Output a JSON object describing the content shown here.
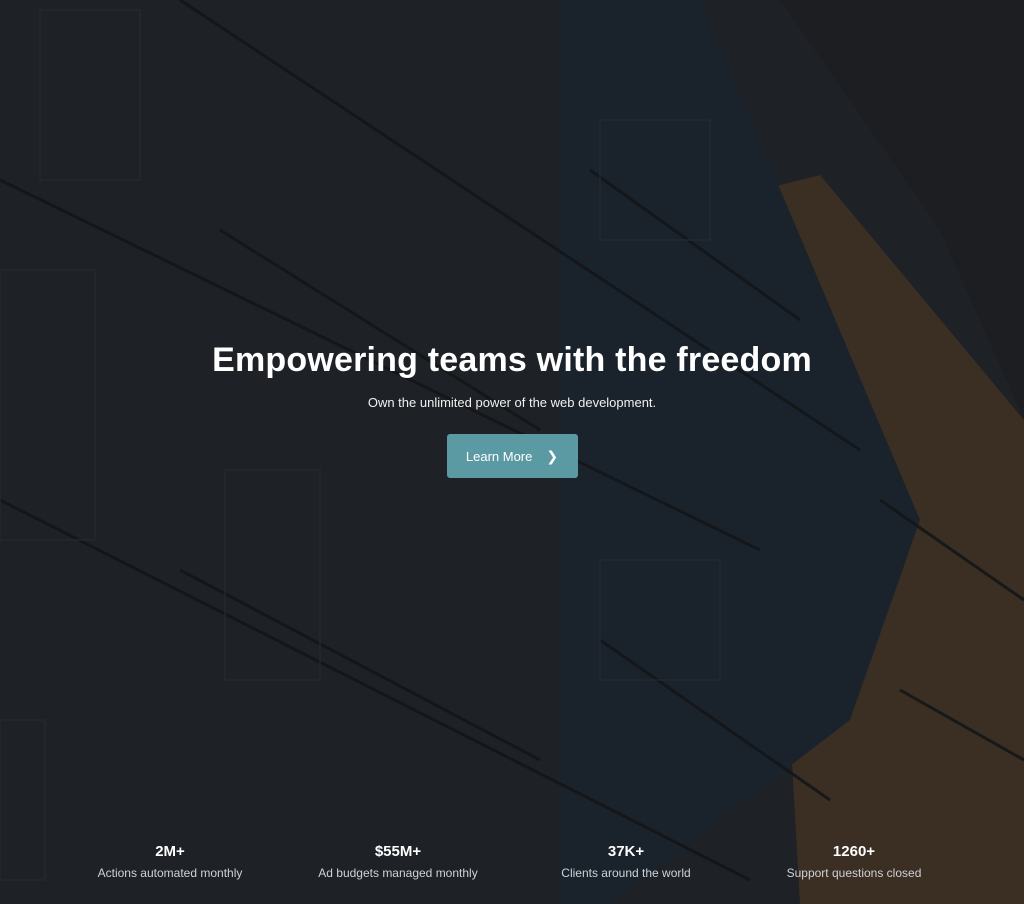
{
  "hero": {
    "title": "Empowering teams with the freedom",
    "subtitle": "Own the unlimited power of the web development.",
    "cta_label": "Learn More",
    "cta_icon": "chevron-right-icon"
  },
  "stats": [
    {
      "value": "2M+",
      "label": "Actions automated monthly"
    },
    {
      "value": "$55M+",
      "label": "Ad budgets managed monthly"
    },
    {
      "value": "37K+",
      "label": "Clients around the world"
    },
    {
      "value": "1260+",
      "label": "Support questions closed"
    }
  ],
  "colors": {
    "accent": "#5b9aa3",
    "overlay": "#1e1f23",
    "text": "#ffffff"
  }
}
